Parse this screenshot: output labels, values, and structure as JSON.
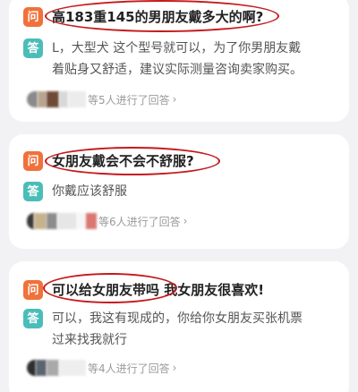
{
  "badges": {
    "question": "问",
    "answer": "答"
  },
  "cards": [
    {
      "question": "高183重145的男朋友戴多大的啊?",
      "answer_line1": "L，大型犬 这个型号就可以，为了你男朋友戴",
      "answer_line2": "着贴身又舒适，建议实际测量咨询卖家购买。",
      "reply_text": "等5人进行了回答",
      "reply_count": 5
    },
    {
      "question": "女朋友戴会不会不舒服?",
      "answer_line1": "你戴应该舒服",
      "reply_text": "等6人进行了回答",
      "reply_count": 6
    },
    {
      "question_circled": "可以给女朋友带吗",
      "question_rest": " 我女朋友很喜欢!",
      "answer_line1": "可以，我这有现成的，你给你女朋友买张机票",
      "answer_line2": "过来找我就行",
      "reply_text": "等4人进行了回答",
      "reply_count": 4
    }
  ],
  "chevron": "›",
  "colors": {
    "question_badge": "#f0713a",
    "answer_badge": "#4bbdb8",
    "annotation_ring": "#c5191b"
  }
}
